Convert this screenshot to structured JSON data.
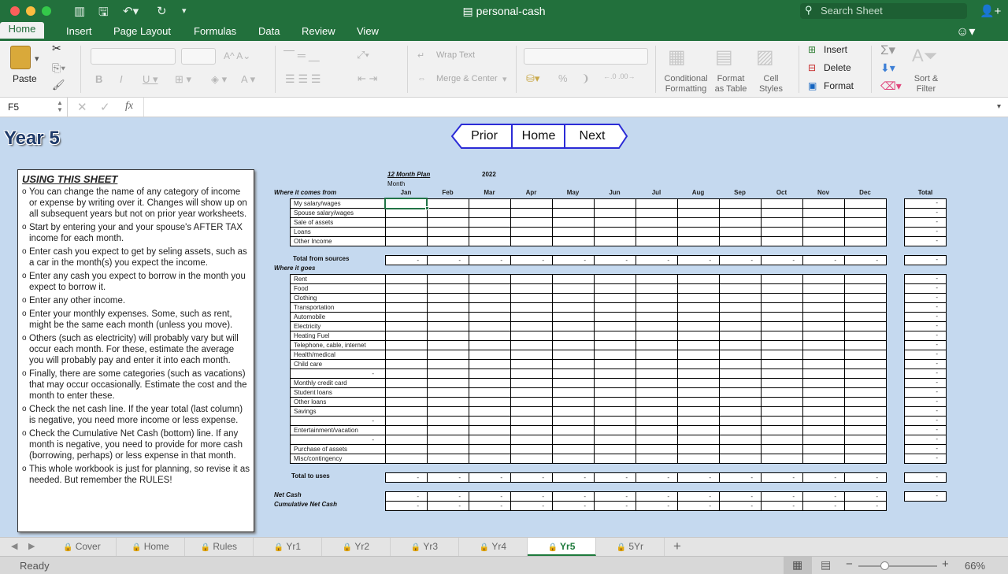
{
  "window": {
    "title": "personal-cash",
    "search_placeholder": "Search Sheet"
  },
  "ribbon_tabs": [
    "Home",
    "Insert",
    "Page Layout",
    "Formulas",
    "Data",
    "Review",
    "View"
  ],
  "ribbon": {
    "paste": "Paste",
    "wrap_text": "Wrap Text",
    "merge_center": "Merge & Center",
    "conditional": "Conditional",
    "formatting": "Formatting",
    "format": "Format",
    "as_table": "as Table",
    "cell": "Cell",
    "styles": "Styles",
    "insert": "Insert",
    "delete": "Delete",
    "format_btn": "Format",
    "sort": "Sort &",
    "filter": "Filter"
  },
  "formula_bar": {
    "name_box": "F5",
    "fx": "fx",
    "value": ""
  },
  "sheet": {
    "title": "Year 5",
    "nav": {
      "prior": "Prior",
      "home": "Home",
      "next": "Next"
    },
    "instructions": {
      "heading": "USING THIS SHEET",
      "items": [
        "You can change the name of any category of income or expense by writing over it. Changes will show up on all subsequent years but not on prior year worksheets.",
        "Start by entering your and your spouse's AFTER TAX income for each month.",
        "Enter cash you expect to get by seling assets, such as a car in the month(s) you expect the income.",
        "Enter any cash you expect to borrow in the month you expect to borrow it.",
        "Enter any other income.",
        "Enter your monthly expenses. Some, such as rent, might be the same each month (unless you move).",
        " Others (such as electricity) will probably vary but will occur each month. For these, estimate the average you will probably pay and enter it into each month.",
        "Finally, there are some categories (such as vacations) that may occur occasionally. Estimate the cost and the month to enter these.",
        "Check the net cash line. If the year total (last column) is negative, you need more income or less expense.",
        "Check the Cumulative Net Cash (bottom) line. If any month is negative, you need to provide for more cash (borrowing, perhaps) or less expense in that month.",
        "This whole workbook is just for planning, so revise it as needed. But remember the RULES!"
      ]
    },
    "plan_label": "12 Month Plan",
    "year": "2022",
    "month_label": "Month",
    "months": [
      "Jan",
      "Feb",
      "Mar",
      "Apr",
      "May",
      "Jun",
      "Jul",
      "Aug",
      "Sep",
      "Oct",
      "Nov",
      "Dec"
    ],
    "total_label": "Total",
    "where_from": "Where it comes from",
    "income_rows": [
      "My salary/wages",
      "Spouse salary/wages",
      "Sale of assets",
      "Loans",
      "Other Income"
    ],
    "total_sources": "Total from sources",
    "where_goes": "Where it goes",
    "expense_rows": [
      "Rent",
      "Food",
      "Clothing",
      "Transportation",
      "Automobile",
      "Electricity",
      "Heating Fuel",
      "Telephone, cable, internet",
      "Health/medical",
      "Child care",
      "-",
      "Monthly credit card",
      "Student loans",
      "Other loans",
      "Savings",
      "-",
      "Entertainment/vacation",
      "-",
      "Purchase of assets",
      "Misc/contingency"
    ],
    "total_uses": "Total to uses",
    "net_cash": "Net Cash",
    "cum_net_cash": "Cumulative Net Cash",
    "dash": "-"
  },
  "sheet_tabs": [
    {
      "label": "Cover",
      "active": false
    },
    {
      "label": "Home",
      "active": false
    },
    {
      "label": "Rules",
      "active": false
    },
    {
      "label": "Yr1",
      "active": false
    },
    {
      "label": "Yr2",
      "active": false
    },
    {
      "label": "Yr3",
      "active": false
    },
    {
      "label": "Yr4",
      "active": false
    },
    {
      "label": "Yr5",
      "active": true
    },
    {
      "label": "5Yr",
      "active": false
    }
  ],
  "status": {
    "text": "Ready",
    "zoom": "66%"
  },
  "colors": {
    "brand": "#22703c",
    "sheet_bg": "#c5d9ef",
    "nav_border": "#2b2bd6"
  }
}
